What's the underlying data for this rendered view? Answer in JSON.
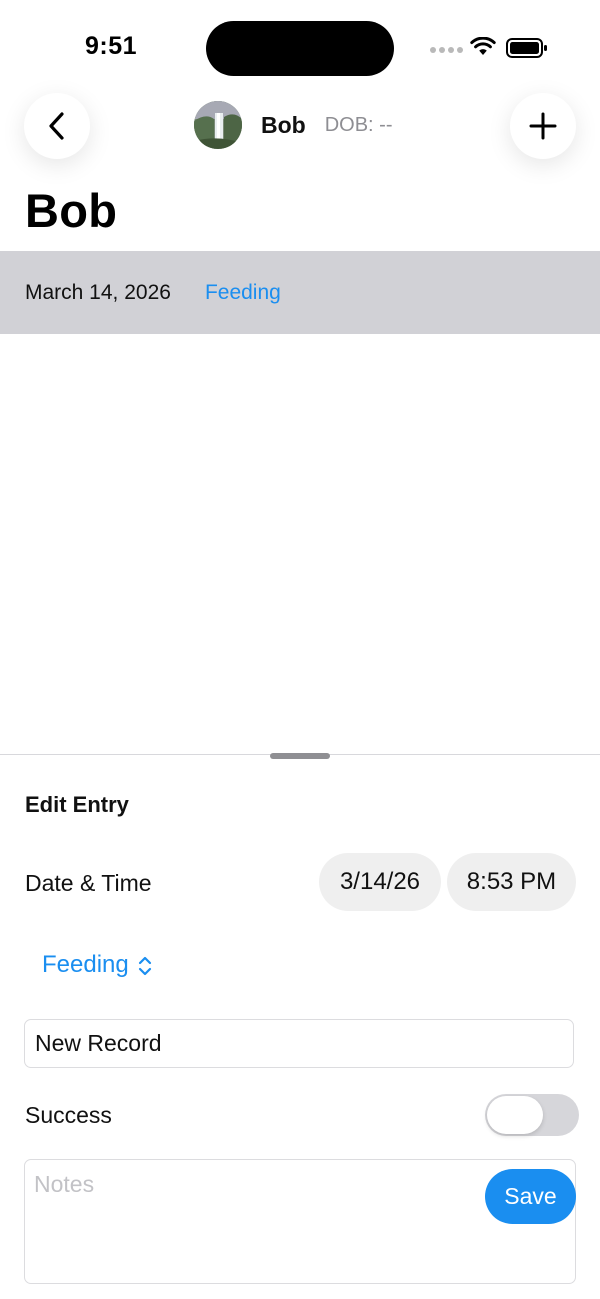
{
  "status_bar": {
    "time": "9:51"
  },
  "nav": {
    "name": "Bob",
    "dob": "DOB: --"
  },
  "page": {
    "title": "Bob"
  },
  "entries": [
    {
      "date": "March 14, 2026",
      "category": "Feeding"
    }
  ],
  "sheet": {
    "title": "Edit Entry",
    "date_time_label": "Date & Time",
    "date_value": "3/14/26",
    "time_value": "8:53 PM",
    "category_value": "Feeding",
    "record_name_value": "New Record",
    "success_label": "Success",
    "success_enabled": false,
    "notes_placeholder": "Notes",
    "save_label": "Save"
  },
  "colors": {
    "accent": "#1a8ef0",
    "row_highlight": "#d1d1d6",
    "toggle_off": "#d6d6da"
  },
  "icons": {
    "back": "chevron-left-icon",
    "add": "plus-icon",
    "category_picker": "chevron-up-down-icon"
  }
}
